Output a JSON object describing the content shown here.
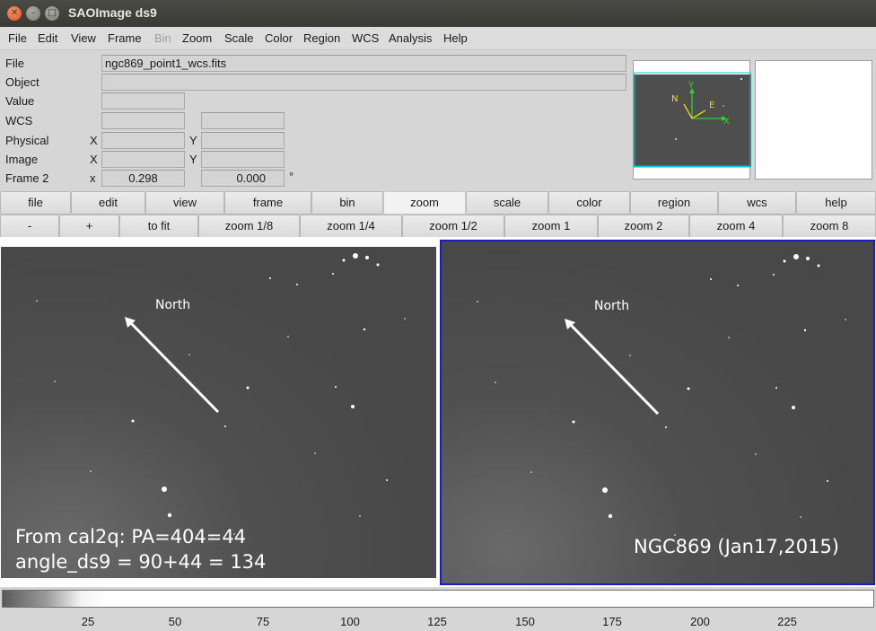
{
  "window": {
    "title": "SAOImage ds9"
  },
  "menubar": [
    {
      "label": "File",
      "enabled": true
    },
    {
      "label": "Edit",
      "enabled": true
    },
    {
      "label": "View",
      "enabled": true
    },
    {
      "label": "Frame",
      "enabled": true
    },
    {
      "label": "Bin",
      "enabled": false
    },
    {
      "label": "Zoom",
      "enabled": true
    },
    {
      "label": "Scale",
      "enabled": true
    },
    {
      "label": "Color",
      "enabled": true
    },
    {
      "label": "Region",
      "enabled": true
    },
    {
      "label": "WCS",
      "enabled": true
    },
    {
      "label": "Analysis",
      "enabled": true
    },
    {
      "label": "Help",
      "enabled": true
    }
  ],
  "info": {
    "file_label": "File",
    "file_value": "ngc869_point1_wcs.fits",
    "object_label": "Object",
    "object_value": "",
    "value_label": "Value",
    "wcs_label": "WCS",
    "physical_label": "Physical",
    "image_label": "Image",
    "frame_label": "Frame 2",
    "x_label": "X",
    "y_label": "Y",
    "frame_x_label": "x",
    "frame_zoom": "0.298",
    "frame_angle": "0.000",
    "degree_symbol": "°"
  },
  "panner": {
    "compass": {
      "north": "N",
      "east": "E",
      "x": "X",
      "y": "Y"
    }
  },
  "buttonbar": [
    "file",
    "edit",
    "view",
    "frame",
    "bin",
    "zoom",
    "scale",
    "color",
    "region",
    "wcs",
    "help"
  ],
  "buttonbar_active": "zoom",
  "zoombar": [
    "-",
    "+",
    "to fit",
    "zoom 1/8",
    "zoom 1/4",
    "zoom 1/2",
    "zoom 1",
    "zoom 2",
    "zoom 4",
    "zoom 8"
  ],
  "frames": {
    "left": {
      "north_label": "North",
      "annotation_line1": "From cal2q:  PA=404=44",
      "annotation_line2": "angle_ds9 = 90+44 = 134"
    },
    "right": {
      "north_label": "North",
      "annotation": "NGC869 (Jan17,2015)"
    }
  },
  "colorbar": {
    "ticks": [
      "25",
      "50",
      "75",
      "100",
      "125",
      "150",
      "175",
      "200",
      "225"
    ]
  },
  "colors": {
    "active_frame_border": "#1c1cc0",
    "compass_yellow": "#f0e000",
    "compass_green": "#30d030",
    "panner_box": "#00c8d8"
  }
}
